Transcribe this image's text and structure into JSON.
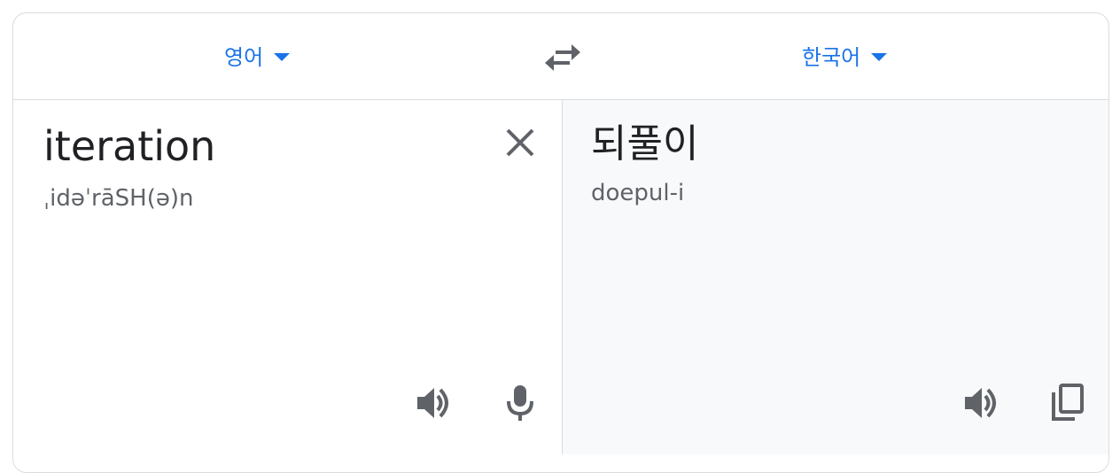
{
  "languages": {
    "source": "영어",
    "target": "한국어"
  },
  "source": {
    "text": "iteration",
    "phonetic": "ˌidəˈrāSH(ə)n"
  },
  "target": {
    "text": "되풀이",
    "romanization": "doepul-i"
  },
  "icons": {
    "swap": "swap-arrows-icon",
    "clear": "close-icon",
    "speak": "speaker-icon",
    "mic": "microphone-icon",
    "copy": "copy-icon"
  },
  "colors": {
    "accent": "#1a73e8",
    "icon": "#5f6368",
    "divider": "#dadce0",
    "target_bg": "#f8f9fa"
  }
}
